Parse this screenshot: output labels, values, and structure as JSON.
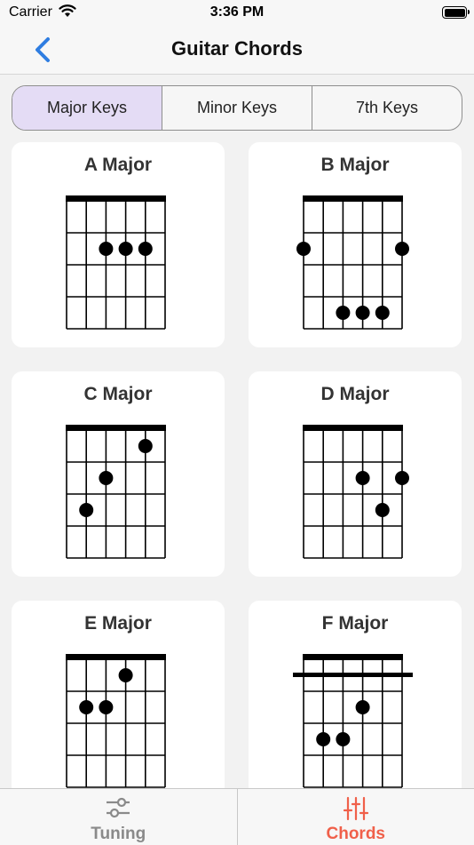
{
  "status": {
    "carrier": "Carrier",
    "time": "3:36 PM"
  },
  "nav": {
    "title": "Guitar Chords"
  },
  "segments": [
    "Major Keys",
    "Minor Keys",
    "7th Keys"
  ],
  "chords": [
    {
      "name": "A Major",
      "barre": false,
      "dots": [
        [
          2,
          2
        ],
        [
          3,
          2
        ],
        [
          4,
          2
        ]
      ]
    },
    {
      "name": "B Major",
      "barre": false,
      "dots": [
        [
          0,
          2
        ],
        [
          5,
          2
        ],
        [
          2,
          4
        ],
        [
          3,
          4
        ],
        [
          4,
          4
        ]
      ]
    },
    {
      "name": "C Major",
      "barre": false,
      "dots": [
        [
          4,
          1
        ],
        [
          2,
          2
        ],
        [
          1,
          3
        ]
      ]
    },
    {
      "name": "D Major",
      "barre": false,
      "dots": [
        [
          3,
          2
        ],
        [
          5,
          2
        ],
        [
          4,
          3
        ]
      ]
    },
    {
      "name": "E Major",
      "barre": false,
      "dots": [
        [
          3,
          1
        ],
        [
          1,
          2
        ],
        [
          2,
          2
        ]
      ]
    },
    {
      "name": "F Major",
      "barre": true,
      "dots": [
        [
          3,
          2
        ],
        [
          1,
          3
        ],
        [
          2,
          3
        ]
      ]
    }
  ],
  "tabs": {
    "tuning": "Tuning",
    "chords": "Chords"
  },
  "colors": {
    "accent_active": "#f0604a",
    "segment_active": "#e4dcf5",
    "back": "#2f7de1"
  }
}
